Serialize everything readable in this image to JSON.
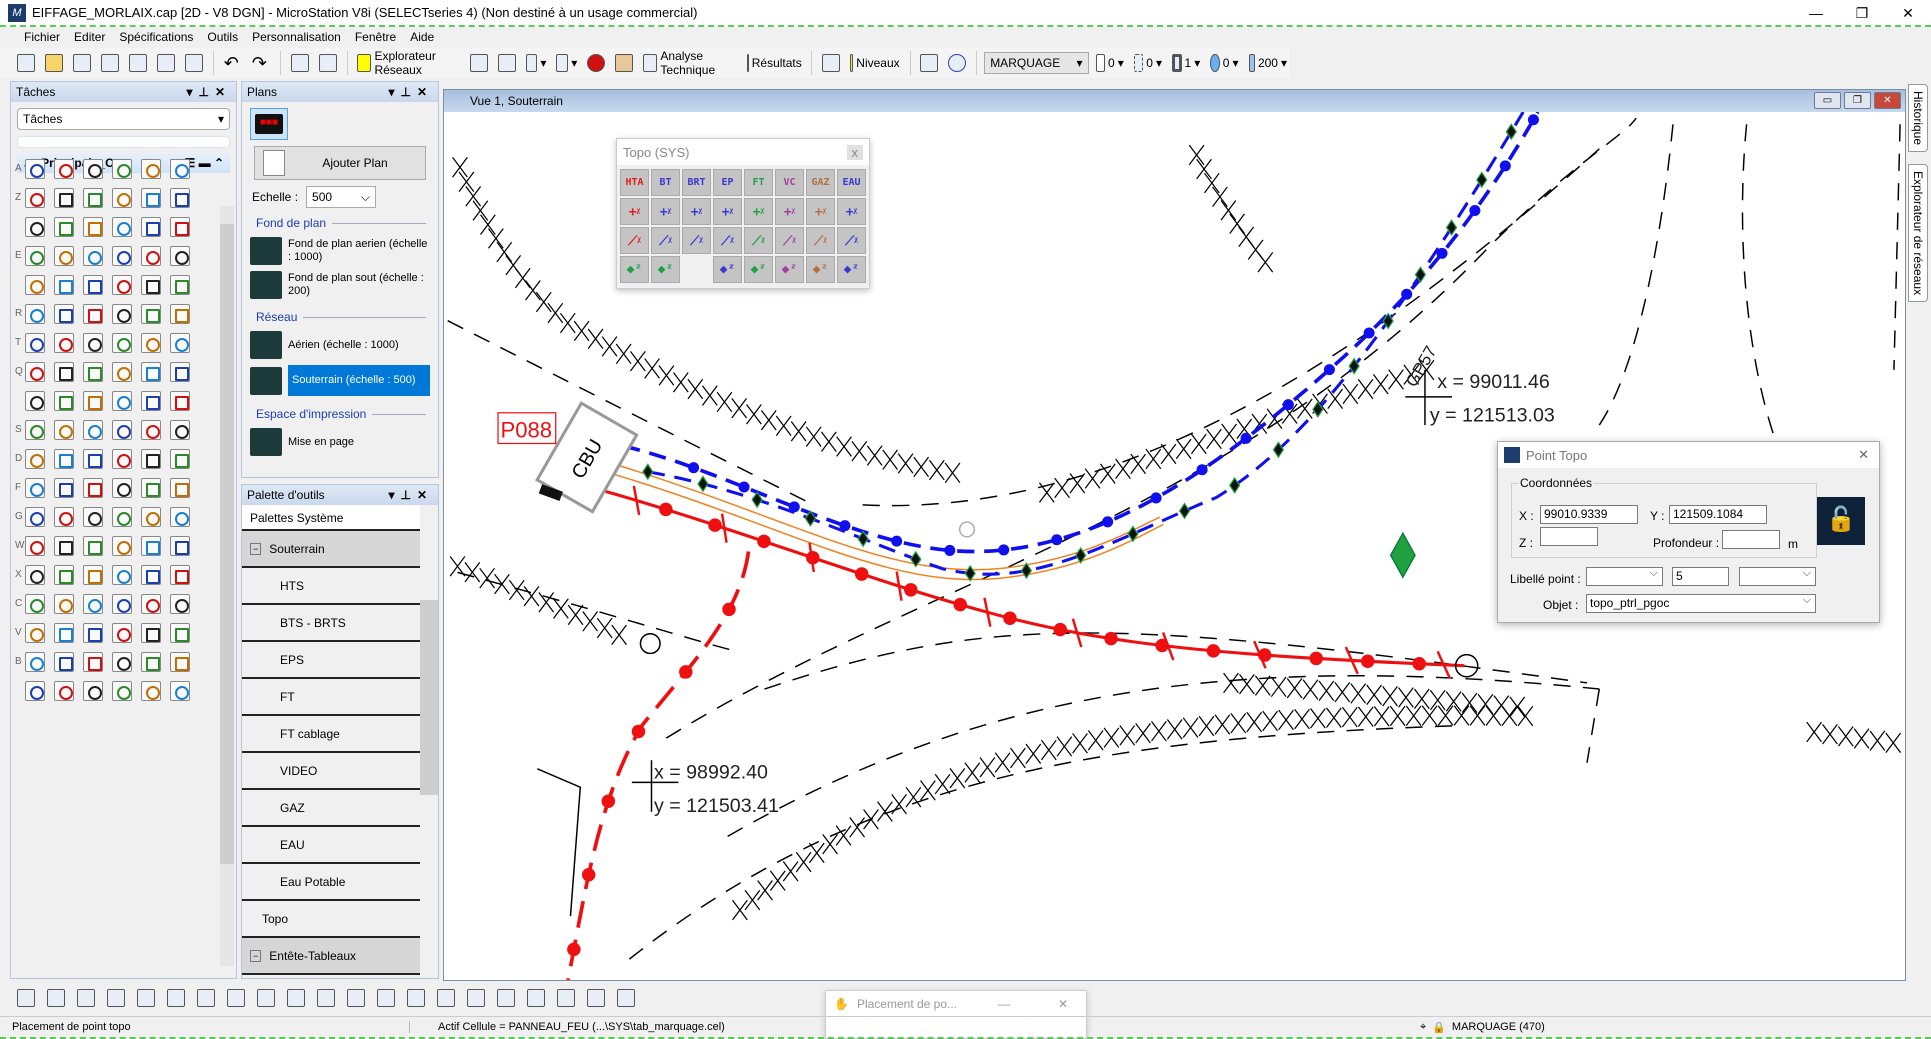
{
  "window": {
    "title": "EIFFAGE_MORLAIX.cap [2D - V8 DGN] - MicroStation V8i (SELECTseries 4) (Non destiné à un usage commercial)",
    "minimize": "—",
    "maximize": "❐",
    "close": "✕"
  },
  "menu": [
    "Fichier",
    "Editer",
    "Spécifications",
    "Outils",
    "Personnalisation",
    "Fenêtre",
    "Aide"
  ],
  "toolbar": {
    "explorer": "Explorateur Réseaux",
    "analysis": "Analyse Technique",
    "results": "Résultats",
    "levels": "Niveaux",
    "level_value": "MARQUAGE",
    "color_value": "0",
    "style_value": "0",
    "weight_value": "1",
    "transparency_value": "0",
    "priority_value": "200"
  },
  "tasks": {
    "title": "Tâches",
    "selector": "Tâches",
    "group": "Principale_C...",
    "row_letters": [
      "A",
      "Z",
      "",
      "E",
      "",
      "R",
      "T",
      "Q",
      "",
      "S",
      "D",
      "F",
      "G",
      "W",
      "X",
      "C",
      "V",
      "B",
      ""
    ]
  },
  "plans": {
    "title": "Plans",
    "add_plan": "Ajouter Plan",
    "scale_label": "Echelle :",
    "scale_value": "500",
    "sections": [
      {
        "title": "Fond de plan",
        "items": [
          "Fond de plan aerien (échelle : 1000)",
          "Fond de plan sout (échelle : 200)"
        ]
      },
      {
        "title": "Réseau",
        "items": [
          "Aérien (échelle : 1000)",
          "Souterrain (échelle : 500)"
        ]
      },
      {
        "title": "Espace d'impression",
        "items": [
          "Mise en page"
        ]
      }
    ],
    "selected": "Souterrain (échelle : 500)"
  },
  "palette": {
    "title": "Palette d'outils",
    "header": "Palettes Système",
    "rows": [
      {
        "label": "Souterrain",
        "group": true
      },
      {
        "label": "HTS"
      },
      {
        "label": "BTS - BRTS"
      },
      {
        "label": "EPS"
      },
      {
        "label": "FT"
      },
      {
        "label": "FT cablage"
      },
      {
        "label": "VIDEO"
      },
      {
        "label": "GAZ"
      },
      {
        "label": "EAU"
      },
      {
        "label": "Eau Potable"
      },
      {
        "label": "Topo",
        "top": true
      },
      {
        "label": "Entête-Tableaux",
        "group": true
      }
    ]
  },
  "view": {
    "title": "Vue 1, Souterrain"
  },
  "topo_palette": {
    "title": "Topo (SYS)",
    "close": "x",
    "headers": [
      {
        "t": "HTA",
        "c": "#e0201c"
      },
      {
        "t": "BT",
        "c": "#3a3ad0"
      },
      {
        "t": "BRT",
        "c": "#3a3ad0"
      },
      {
        "t": "EP",
        "c": "#3a3ad0"
      },
      {
        "t": "FT",
        "c": "#20a040"
      },
      {
        "t": "VC",
        "c": "#a040a0"
      },
      {
        "t": "GAZ",
        "c": "#b07040"
      },
      {
        "t": "EAU",
        "c": "#3a3ad0"
      }
    ]
  },
  "point_topo": {
    "title": "Point Topo",
    "group": "Coordonnées",
    "x_label": "X :",
    "x_value": "99010.9339",
    "y_label": "Y :",
    "y_value": "121509.1084",
    "z_label": "Z :",
    "z_value": "",
    "depth_label": "Profondeur :",
    "depth_value": "",
    "depth_unit": "m",
    "label_label": "Libellé point :",
    "label_value": "",
    "label_number": "5",
    "label_suffix": "",
    "object_label": "Objet :",
    "object_value": "topo_ptrl_pgoc",
    "lock_state": "unlocked",
    "close": "✕"
  },
  "drawing": {
    "cabinet_id": "P088",
    "cabinet_type": "CBU",
    "point_name": "GP57",
    "point1_x": "x = 99011.46",
    "point1_y": "y = 121513.03",
    "point2_x": "x = 98992.40",
    "point2_y": "y = 121503.41",
    "colors": {
      "bt": "#1010ee",
      "hta": "#ee1010",
      "ft": "#f08020",
      "diamond": "#20a040"
    }
  },
  "placement": {
    "title": "Placement de po...",
    "minimize": "—",
    "close": "✕"
  },
  "status": {
    "prompt": "Placement de point topo",
    "active_cell": "Actif Cellule = PANNEAU_FEU (...\\SYS\\tab_marquage.cel)",
    "level": "MARQUAGE (470)"
  },
  "right_tabs": [
    "Historique",
    "Explorateur de réseaux"
  ]
}
